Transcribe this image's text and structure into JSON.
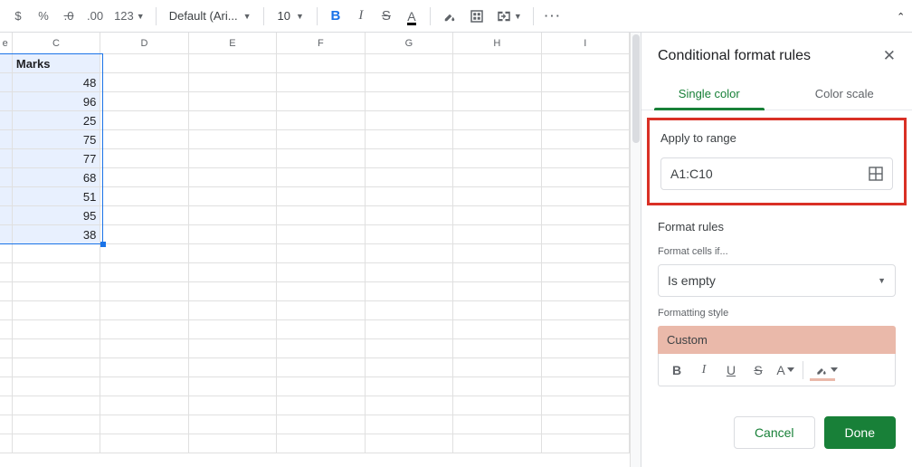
{
  "toolbar": {
    "currency": "$",
    "percent": "%",
    "dec_dec": ".0",
    "inc_dec": ".00",
    "more_formats": "123",
    "font": "Default (Ari...",
    "font_size": "10",
    "bold": "B",
    "italic": "I",
    "strike": "S",
    "text_color": "A",
    "more": "···"
  },
  "columns": [
    "C",
    "D",
    "E",
    "F",
    "G",
    "H",
    "I"
  ],
  "col_b_tail": "e",
  "data": {
    "header_c": "Marks",
    "values": [
      48,
      96,
      25,
      75,
      77,
      68,
      51,
      95,
      38
    ]
  },
  "total_rows": 21,
  "sidebar": {
    "title": "Conditional format rules",
    "tabs": {
      "single": "Single color",
      "scale": "Color scale"
    },
    "apply_range_label": "Apply to range",
    "range_value": "A1:C10",
    "format_rules_label": "Format rules",
    "format_cells_if": "Format cells if...",
    "condition": "Is empty",
    "formatting_style_label": "Formatting style",
    "style_name": "Custom",
    "style_btns": {
      "b": "B",
      "i": "I",
      "u": "U",
      "s": "S",
      "a": "A"
    },
    "cancel": "Cancel",
    "done": "Done"
  }
}
